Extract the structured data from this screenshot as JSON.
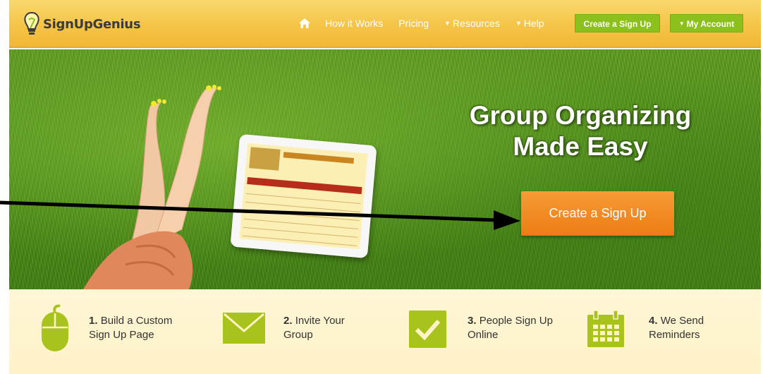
{
  "brand": {
    "name": "SignUpGenius"
  },
  "nav": {
    "home_icon": "home-icon",
    "links": [
      {
        "label": "How it Works",
        "has_caret": false
      },
      {
        "label": "Pricing",
        "has_caret": false
      },
      {
        "label": "Resources",
        "has_caret": true
      },
      {
        "label": "Help",
        "has_caret": true
      }
    ],
    "create_button": "Create a Sign Up",
    "account_button": "My Account"
  },
  "hero": {
    "title_line1": "Group Organizing",
    "title_line2": "Made Easy",
    "cta_label": "Create a Sign Up"
  },
  "steps": [
    {
      "num": "1.",
      "text": "Build a Custom Sign Up Page",
      "icon": "mouse-icon"
    },
    {
      "num": "2.",
      "text": "Invite Your Group",
      "icon": "envelope-icon"
    },
    {
      "num": "3.",
      "text": "People Sign Up Online",
      "icon": "checkmark-icon"
    },
    {
      "num": "4.",
      "text": "We Send Reminders",
      "icon": "calendar-icon"
    }
  ],
  "colors": {
    "nav_bg": "#f5c447",
    "green_accent": "#8cc11d",
    "cta_orange": "#f08a20",
    "step_icon_green": "#a8c31c",
    "steps_bg": "#fef2c8"
  }
}
